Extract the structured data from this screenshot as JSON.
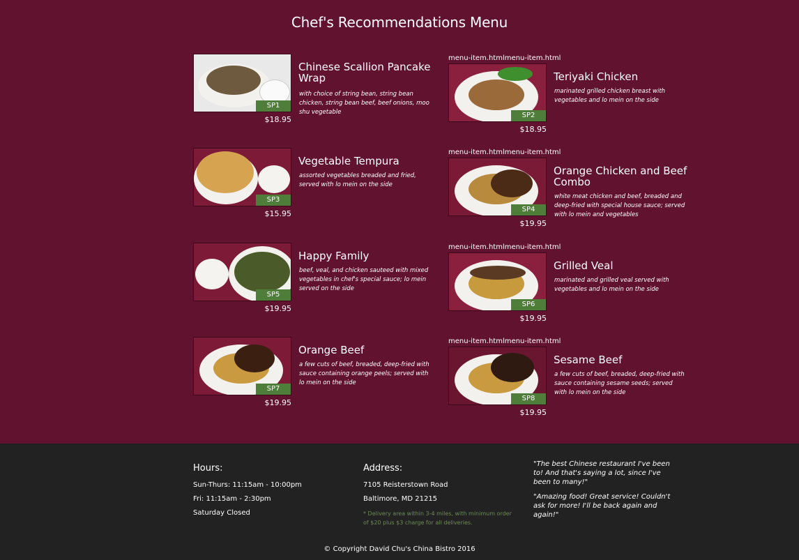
{
  "page": {
    "title": "Chef's Recommendations Menu"
  },
  "leak_text": "menu-item.htmlmenu-item.html",
  "items": [
    {
      "code": "SP1",
      "name": "Chinese Scallion Pancake Wrap",
      "desc": "with choice of string bean, string bean chicken, string bean beef, beef onions, moo shu vegetable",
      "price": "$18.95"
    },
    {
      "code": "SP2",
      "name": "Teriyaki Chicken",
      "desc": "marinated grilled chicken breast with vegetables and lo mein on the side",
      "price": "$18.95"
    },
    {
      "code": "SP3",
      "name": "Vegetable Tempura",
      "desc": "assorted vegetables breaded and fried, served with lo mein on the side",
      "price": "$15.95"
    },
    {
      "code": "SP4",
      "name": "Orange Chicken and Beef Combo",
      "desc": "white meat chicken and beef, breaded and deep-fried with special house sauce; served with lo mein and vegetables",
      "price": "$19.95"
    },
    {
      "code": "SP5",
      "name": "Happy Family",
      "desc": "beef, veal, and chicken sauteed with mixed vegetables in chef's special sauce; lo mein served on the side",
      "price": "$19.95"
    },
    {
      "code": "SP6",
      "name": "Grilled Veal",
      "desc": "marinated and grilled veal served with vegetables and lo mein on the side",
      "price": "$19.95"
    },
    {
      "code": "SP7",
      "name": "Orange Beef",
      "desc": "a few cuts of beef, breaded, deep-fried with sauce containing orange peels; served with lo mein on the side",
      "price": "$19.95"
    },
    {
      "code": "SP8",
      "name": "Sesame Beef",
      "desc": "a few cuts of beef, breaded, deep-fried with sauce containing sesame seeds; served with lo mein on the side",
      "price": "$19.95"
    }
  ],
  "footer": {
    "hours": {
      "heading": "Hours:",
      "lines": [
        "Sun-Thurs: 11:15am - 10:00pm",
        "Fri: 11:15am - 2:30pm",
        "Saturday Closed"
      ]
    },
    "address": {
      "heading": "Address:",
      "lines": [
        "7105 Reisterstown Road",
        "Baltimore, MD 21215"
      ],
      "note": "* Delivery area within 3-4 miles, with minimum order of $20 plus $3 charge for all deliveries."
    },
    "quotes": [
      "\"The best Chinese restaurant I've been to! And that's saying a lot, since I've been to many!\"",
      "\"Amazing food! Great service! Couldn't ask for more! I'll be back again and again!\""
    ],
    "copyright": "© Copyright David Chu's China Bistro 2016"
  },
  "colors": {
    "background": "#61122f",
    "footer": "#222222",
    "badge": "#4f7d3a",
    "note": "#6e8a56"
  }
}
